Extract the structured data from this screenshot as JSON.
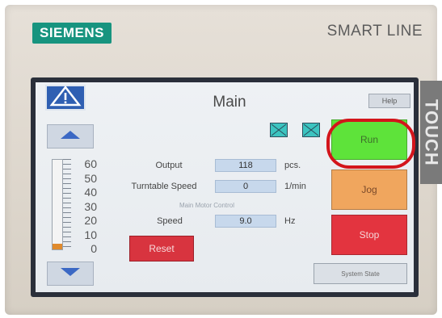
{
  "device": {
    "brand": "SIEMENS",
    "model": "SMART LINE",
    "side_label": "TOUCH"
  },
  "screen": {
    "title": "Main",
    "help_label": "Help",
    "section_label": "Main Motor Control",
    "reset_label": "Reset",
    "system_state_label": "System State"
  },
  "gauge": {
    "scale": [
      "60",
      "50",
      "40",
      "30",
      "20",
      "10",
      "0"
    ],
    "level_value": 4,
    "max_value": 60,
    "fill_color": "#e08a2c"
  },
  "rows": [
    {
      "label": "Output",
      "value": "118",
      "unit": "pcs."
    },
    {
      "label": "Turntable Speed",
      "value": "0",
      "unit": "1/min"
    },
    {
      "label": "Speed",
      "value": "9.0",
      "unit": "Hz"
    }
  ],
  "controls": {
    "run_label": "Run",
    "jog_label": "Jog",
    "stop_label": "Stop",
    "run_color": "#5ee33a",
    "jog_color": "#f0a65e",
    "stop_color": "#e3343f",
    "highlight_color": "#d3151b"
  },
  "icons": {
    "warning": "warning-triangle-icon",
    "arrow_up": "arrow-up-icon",
    "arrow_down": "arrow-down-icon",
    "status": "status-indicator-icon"
  }
}
